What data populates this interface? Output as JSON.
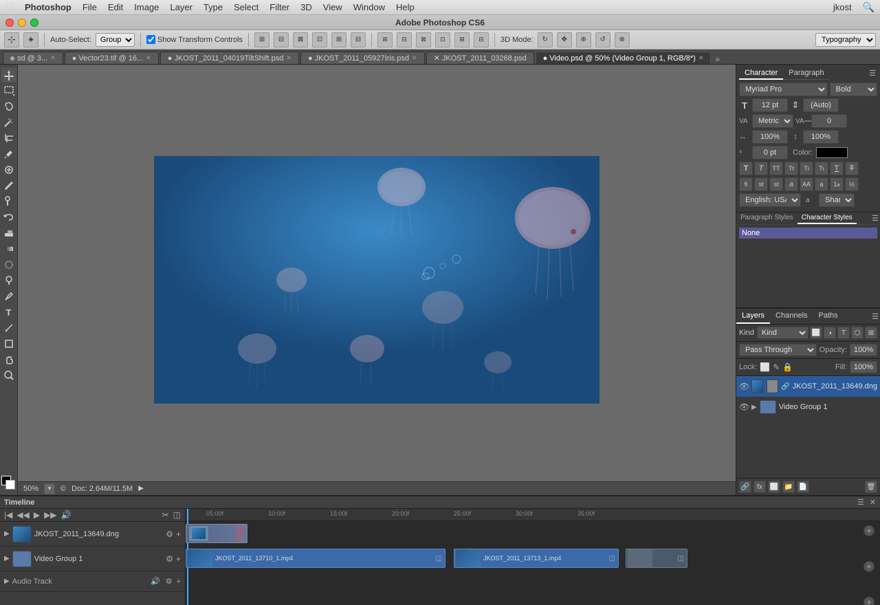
{
  "menubar": {
    "apple": "⌘",
    "app_name": "Photoshop",
    "items": [
      "File",
      "Edit",
      "Image",
      "Layer",
      "Type",
      "Select",
      "Filter",
      "3D",
      "View",
      "Window",
      "Help"
    ],
    "username": "jkost",
    "search_icon": "🔍"
  },
  "titlebar": {
    "title": "Adobe Photoshop CS6"
  },
  "optionsbar": {
    "auto_select_label": "Auto-Select:",
    "auto_select_value": "Group",
    "show_transform_label": "Show Transform Controls",
    "three_d_mode": "3D Mode:",
    "typography_label": "Typography"
  },
  "tabs": [
    {
      "label": "sd @ 3...",
      "active": false,
      "icon": "dot"
    },
    {
      "label": "Vector23.tif @ 16...",
      "active": false,
      "icon": "dot"
    },
    {
      "label": "JKOST_2011_04019TiltShift.psd",
      "active": false,
      "icon": "dot"
    },
    {
      "label": "JKOST_2011_05927Iris.psd",
      "active": false,
      "icon": "dot"
    },
    {
      "label": "JKOST_2011_03268.psd",
      "active": false,
      "icon": "dot"
    },
    {
      "label": "Video.psd @ 50% (Video Group 1, RGB/8*)",
      "active": true,
      "icon": "dot"
    }
  ],
  "statusbar": {
    "zoom": "50%",
    "doc_info": "Doc: 2.64M/11.5M"
  },
  "character_panel": {
    "tab_character": "Character",
    "tab_paragraph": "Paragraph",
    "font_family": "Myriad Pro",
    "font_style": "Bold",
    "font_size": "12 pt",
    "leading": "(Auto)",
    "kerning_label": "VA",
    "kerning": "Metrics",
    "tracking": "0",
    "scale_h": "100%",
    "scale_v": "100%",
    "baseline": "0 pt",
    "color_label": "Color:",
    "aa_method": "Sharp",
    "language": "English: USA"
  },
  "paragraph_styles": {
    "tab_label": "Paragraph Styles",
    "char_styles_label": "Character Styles",
    "items": [
      "None"
    ]
  },
  "layers_panel": {
    "tab_layers": "Layers",
    "tab_channels": "Channels",
    "tab_paths": "Paths",
    "kind_label": "Kind",
    "blend_mode": "Pass Through",
    "opacity_label": "Opacity:",
    "opacity_value": "100%",
    "lock_label": "Lock:",
    "fill_label": "Fill:",
    "fill_value": "100%",
    "layers": [
      {
        "name": "JKOST_2011_13649.dng",
        "visible": true,
        "selected": true,
        "type": "image"
      },
      {
        "name": "Video Group 1",
        "visible": true,
        "selected": false,
        "type": "group",
        "expanded": true
      }
    ]
  },
  "timeline": {
    "title": "Timeline",
    "tracks": [
      {
        "name": "JKOST_2011_13649.dng",
        "type": "video"
      },
      {
        "name": "Video Group 1",
        "type": "group"
      }
    ],
    "audio_track": "Audio Track",
    "time_markers": [
      "05:00f",
      "10:00f",
      "15:00f",
      "20:00f",
      "25:00f",
      "30:00f",
      "35:00f"
    ],
    "clips": [
      {
        "name": "JKOST_2011_13710_1.mp4",
        "color": "#3a6aaa"
      },
      {
        "name": "JKOST_2011_13713_1.mp4",
        "color": "#3a6aaa"
      }
    ]
  },
  "tools": [
    "move",
    "marquee",
    "lasso",
    "magic-wand",
    "crop",
    "eyedropper",
    "healing",
    "brush",
    "clone",
    "history",
    "eraser",
    "gradient",
    "blur",
    "dodge",
    "pen",
    "text",
    "path-selection",
    "shape",
    "hand",
    "zoom"
  ]
}
